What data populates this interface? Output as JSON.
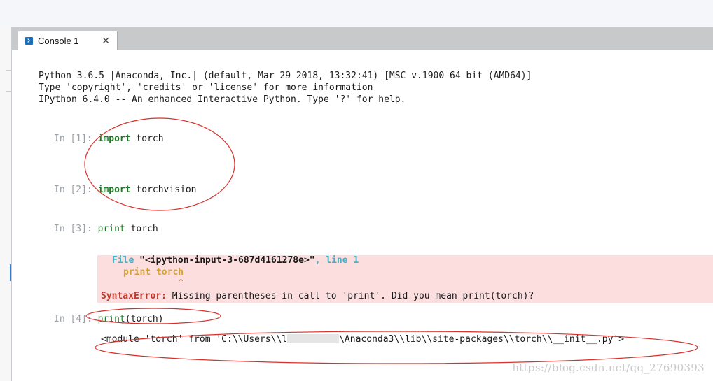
{
  "tab": {
    "label": "Console 1",
    "close": "✕",
    "icon": "console-icon"
  },
  "banner": [
    "Python 3.6.5 |Anaconda, Inc.| (default, Mar 29 2018, 13:32:41) [MSC v.1900 64 bit (AMD64)]",
    "Type 'copyright', 'credits' or 'license' for more information",
    "IPython 6.4.0 -- An enhanced Interactive Python. Type '?' for help."
  ],
  "cells": [
    {
      "prompt": "In [1]:",
      "keyword": "import",
      "rest": " torch"
    },
    {
      "prompt": "In [2]:",
      "keyword": "import",
      "rest": " torchvision"
    },
    {
      "prompt": "In [3]:",
      "keyword": "print",
      "rest": " torch"
    },
    {
      "prompt": "In [4]:",
      "keyword": "print",
      "rest": "(torch)"
    }
  ],
  "error": {
    "file_label": "File ",
    "file_name": "\"<ipython-input-3-687d4161278e>\"",
    "line_label": ", line 1",
    "code": "print torch",
    "caret": "^",
    "name": "SyntaxError:",
    "message": " Missing parentheses in call to 'print'. Did you mean print(torch)?"
  },
  "output": {
    "prefix": "<module 'torch' from 'C:\\\\Users\\\\l",
    "suffix": "\\Anaconda3\\\\lib\\\\site-packages\\\\torch\\\\__init__.py'>"
  },
  "watermark": "https://blog.csdn.net/qq_27690393",
  "colors": {
    "error_background": "#fddede",
    "annotation_ellipse": "#d9302b",
    "keyword": "#1b7a23"
  }
}
